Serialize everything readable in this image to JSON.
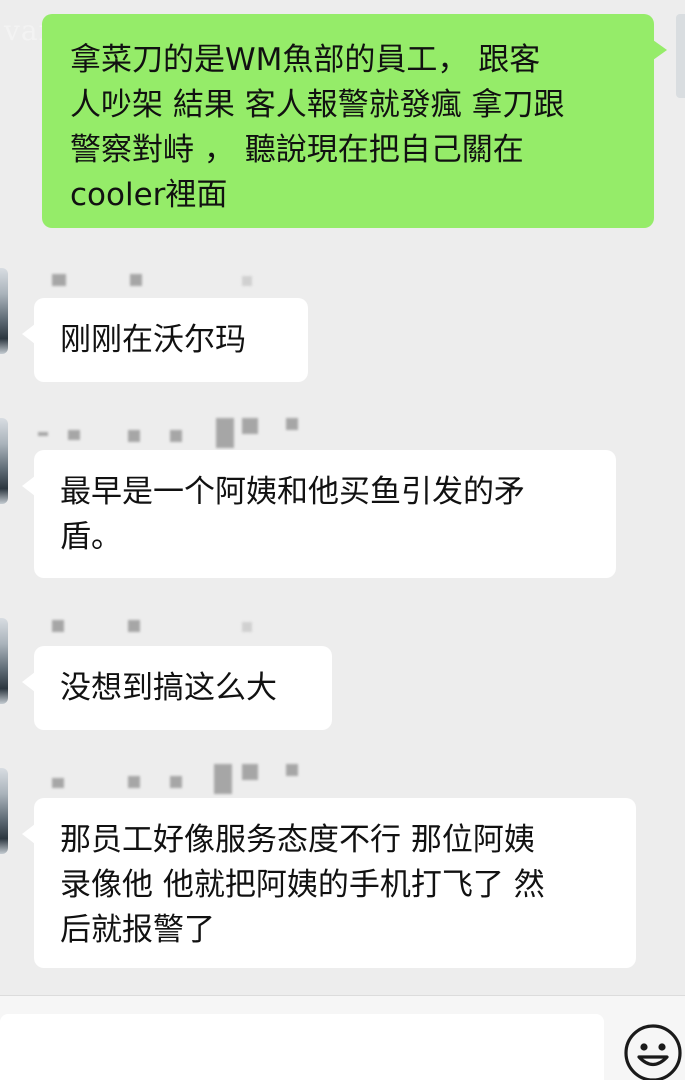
{
  "watermark": "vansky.com",
  "messages": [
    {
      "side": "sent",
      "text": "拿菜刀的是WM魚部的員工， 跟客\n人吵架 結果 客人報警就發瘋 拿刀跟\n警察對峙 ， 聽說現在把自己關在\ncooler裡面"
    },
    {
      "side": "received",
      "text": "刚刚在沃尔玛"
    },
    {
      "side": "received",
      "text": "最早是一个阿姨和他买鱼引发的矛\n盾。"
    },
    {
      "side": "received",
      "text": "没想到搞这么大"
    },
    {
      "side": "received",
      "text": "那员工好像服务态度不行 那位阿姨\n录像他 他就把阿姨的手机打飞了 然\n后就报警了"
    }
  ],
  "input": {
    "value": "",
    "placeholder": ""
  },
  "icons": {
    "emoji_button": "smiley-face-icon"
  },
  "colors": {
    "background": "#ededed",
    "sent_bubble": "#95ec69",
    "received_bubble": "#ffffff"
  }
}
